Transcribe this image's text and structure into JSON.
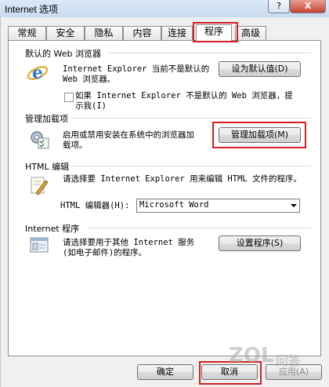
{
  "window": {
    "title": "Internet 选项",
    "help_glyph": "?",
    "close_glyph": "X"
  },
  "tabs": [
    {
      "label": "常规"
    },
    {
      "label": "安全"
    },
    {
      "label": "隐私"
    },
    {
      "label": "内容"
    },
    {
      "label": "连接"
    },
    {
      "label": "程序"
    },
    {
      "label": "高级"
    }
  ],
  "active_tab": "程序",
  "default_browser": {
    "title": "默认的 Web 浏览器",
    "text_line1": "Internet Explorer 当前不是默认的",
    "text_line2": "Web 浏览器。",
    "button": "设为默认值(D)",
    "checkbox_line1": "如果 Internet Explorer 不是默认的 Web 浏览器，提",
    "checkbox_line2": "示我(I)"
  },
  "addons": {
    "title": "管理加载项",
    "text_line1": "启用或禁用安装在系统中的浏览器加",
    "text_line2": "载项。",
    "button": "管理加载项(M)"
  },
  "html_editor": {
    "title": "HTML 编辑",
    "text": "请选择要 Internet Explorer 用来编辑 HTML 文件的程序。",
    "label": "HTML 编辑器(H):",
    "selected": "Microsoft Word"
  },
  "internet_programs": {
    "title": "Internet 程序",
    "text_line1": "请选择要用于其他 Internet 服务",
    "text_line2": "(如电子邮件)的程序。",
    "button": "设置程序(S)"
  },
  "footer": {
    "ok": "确定",
    "cancel": "取消",
    "apply": "应用(A)"
  },
  "watermark": {
    "text1": "ZOL",
    "text2": "问答"
  },
  "colors": {
    "highlight": "#d32020",
    "title_bg": "#d7e4f2"
  }
}
